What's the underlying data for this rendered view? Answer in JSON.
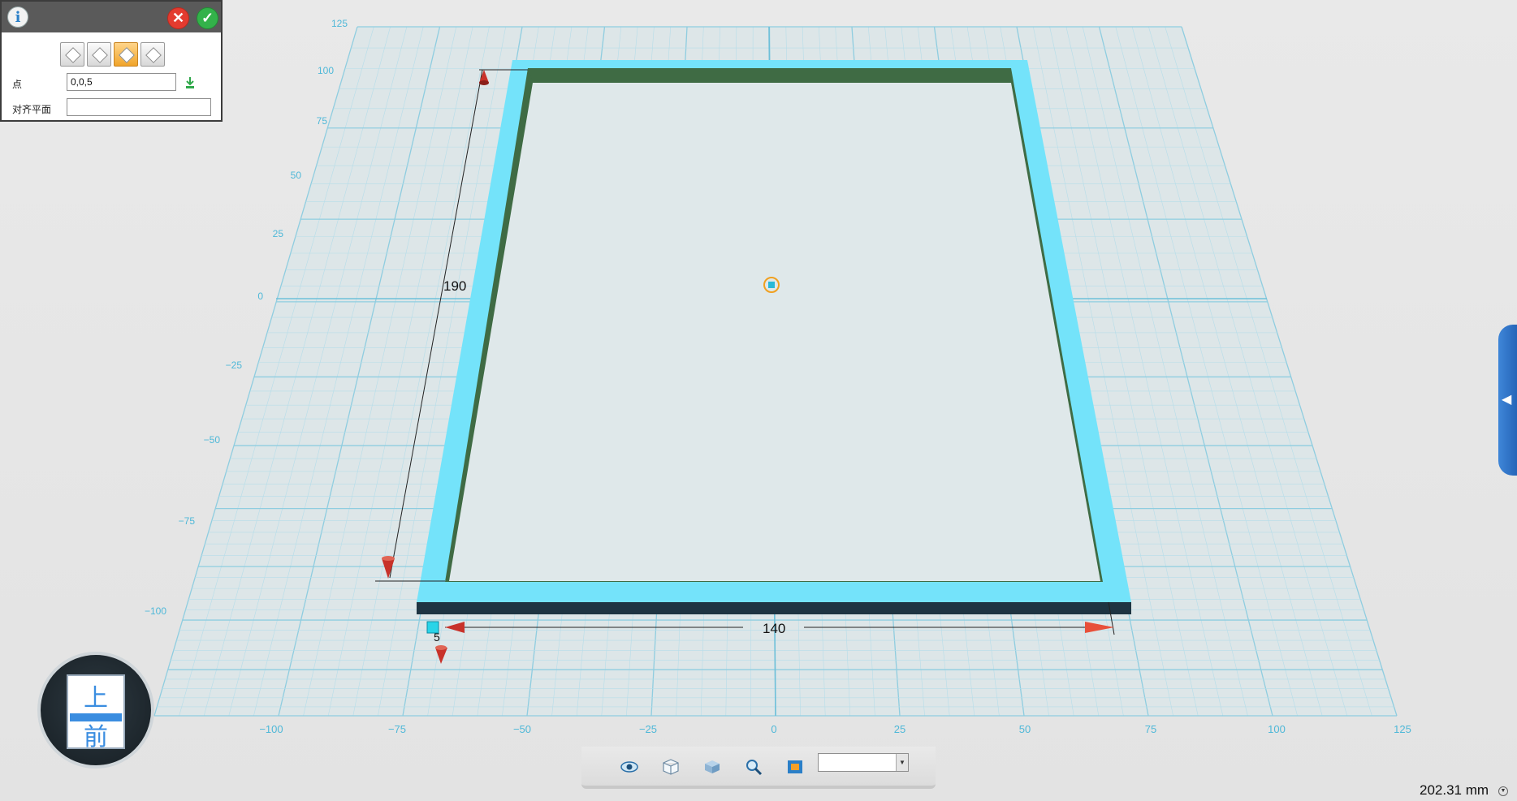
{
  "panel": {
    "info_icon": "info-icon",
    "cancel_icon": "close-icon",
    "confirm_icon": "check-icon",
    "modes": [
      "plane-mode-1",
      "plane-mode-2",
      "plane-mode-3",
      "plane-mode-4"
    ],
    "active_mode": 2,
    "point_label": "点",
    "point_value": "0,0,5",
    "align_label": "对齐平面",
    "align_value": ""
  },
  "grid": {
    "x_ticks": [
      "−100",
      "−75",
      "−50",
      "−25",
      "0",
      "25",
      "50",
      "75",
      "100",
      "125"
    ],
    "y_ticks": [
      "125",
      "100",
      "75",
      "50",
      "25",
      "0",
      "−25",
      "−50",
      "−75",
      "−100"
    ]
  },
  "dimensions": {
    "length": "190",
    "width": "140",
    "offset": "5"
  },
  "view_cube": {
    "top_label": "上",
    "front_label": "前"
  },
  "toolbar": {
    "icons": [
      "eye-icon",
      "cube-wire-icon",
      "cube-solid-icon",
      "zoom-icon",
      "fit-view-icon"
    ],
    "view_select_value": ""
  },
  "status": {
    "scale": "202.31 mm"
  },
  "colors": {
    "frame": "#74e3fa",
    "frame_inner": "#3f6b44",
    "frame_dark": "#1e3442",
    "grid": "#9fd2e2",
    "accent": "#3a8de0"
  }
}
